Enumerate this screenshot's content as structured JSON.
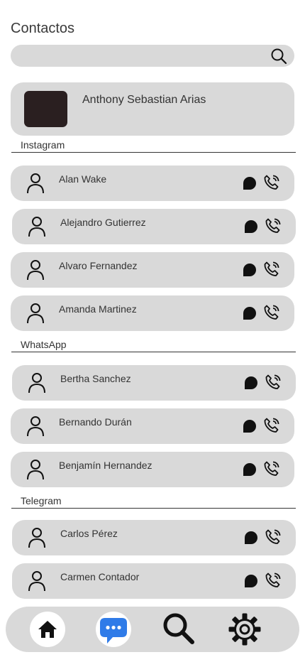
{
  "header": {
    "title": "Contactos"
  },
  "search": {
    "value": "",
    "placeholder": ""
  },
  "profile": {
    "name": "Anthony Sebastian Arias"
  },
  "sections": [
    {
      "label": "Instagram",
      "contacts": [
        "Alan Wake",
        "Alejandro Gutierrez",
        "Alvaro Fernandez",
        "Amanda Martinez"
      ]
    },
    {
      "label": "WhatsApp",
      "contacts": [
        "Bertha Sanchez",
        "Bernando Durán",
        "Benjamín Hernandez"
      ]
    },
    {
      "label": "Telegram",
      "contacts": [
        "Carlos Pérez",
        "Carmen Contador"
      ]
    }
  ],
  "icons": {
    "search": "search-icon",
    "contact": "user-icon",
    "message": "chat-bubble-icon",
    "call": "phone-call-icon",
    "nav": [
      "home-icon",
      "chat-icon",
      "search-icon",
      "settings-gear-icon"
    ]
  },
  "colors": {
    "card": "#d9d9d9",
    "accent": "#2f7be8",
    "photo": "#2a1f20"
  }
}
